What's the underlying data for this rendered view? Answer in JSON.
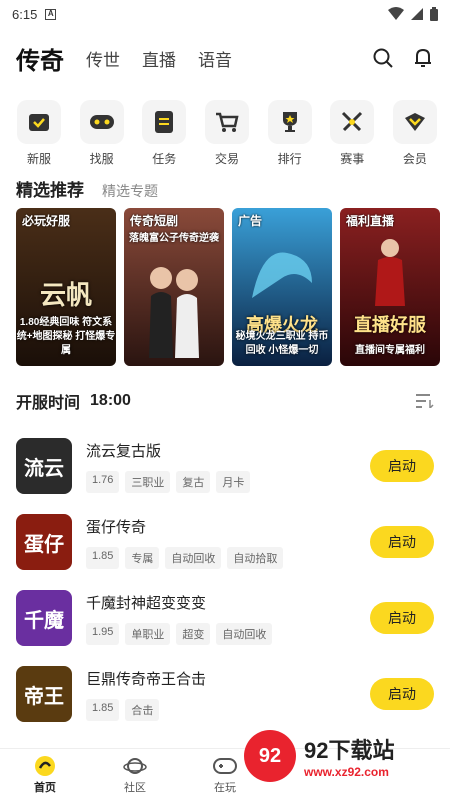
{
  "status": {
    "time": "6:15",
    "a_badge": "A"
  },
  "topnav": {
    "tabs": [
      {
        "label": "传奇",
        "active": true
      },
      {
        "label": "传世"
      },
      {
        "label": "直播"
      },
      {
        "label": "语音"
      }
    ],
    "icons": [
      "search-icon",
      "bell-icon"
    ]
  },
  "categories": [
    {
      "label": "新服",
      "icon": "calendar-icon"
    },
    {
      "label": "找服",
      "icon": "gamepad-icon"
    },
    {
      "label": "任务",
      "icon": "list-icon"
    },
    {
      "label": "交易",
      "icon": "cart-icon"
    },
    {
      "label": "排行",
      "icon": "trophy-icon"
    },
    {
      "label": "赛事",
      "icon": "swords-icon"
    },
    {
      "label": "会员",
      "icon": "vip-icon"
    }
  ],
  "featured": {
    "title": "精选推荐",
    "subtitle": "精选专题"
  },
  "banners": [
    {
      "tag": "必玩好服",
      "text": "云帆",
      "sub": "1.80经典回味 符文系统+地图探秘 打怪爆专属",
      "color": "#3a2414"
    },
    {
      "tag": "传奇短剧",
      "text": "",
      "sub": "落魄富公子传奇逆袭",
      "color": "#5a2a20"
    },
    {
      "tag": "广告",
      "text": "高爆火龙",
      "sub": "秘境火龙三职业 持币回收 小怪爆一切",
      "color": "#14305a"
    },
    {
      "tag": "福利直播",
      "text": "直播好服",
      "sub": "直播间专属福利",
      "color": "#4a0e10"
    }
  ],
  "open_time": {
    "label": "开服时间",
    "time": "18:00"
  },
  "games": [
    {
      "name": "流云复古版",
      "thumb": "流云",
      "thumb_color": "#2b2b2b",
      "tags": [
        "1.76",
        "三职业",
        "复古",
        "月卡"
      ],
      "button": "启动"
    },
    {
      "name": "蛋仔传奇",
      "thumb": "蛋仔",
      "thumb_color": "#8a1d10",
      "tags": [
        "1.85",
        "专属",
        "自动回收",
        "自动拾取"
      ],
      "button": "启动"
    },
    {
      "name": "千魔封神超变变变",
      "thumb": "千魔",
      "thumb_color": "#6a2fa0",
      "tags": [
        "1.95",
        "单职业",
        "超变",
        "自动回收"
      ],
      "button": "启动"
    },
    {
      "name": "巨鼎传奇帝王合击",
      "thumb": "帝王",
      "thumb_color": "#5a3b10",
      "tags": [
        "1.85",
        "合击"
      ],
      "button": "启动"
    }
  ],
  "bottomnav": [
    {
      "label": "首页",
      "active": true
    },
    {
      "label": "社区"
    },
    {
      "label": "在玩"
    }
  ],
  "watermark": {
    "title": "92下载站",
    "url": "www.xz92.com",
    "logo": "92"
  },
  "colors": {
    "accent": "#fbd81f",
    "watermark_red": "#e9232e"
  }
}
